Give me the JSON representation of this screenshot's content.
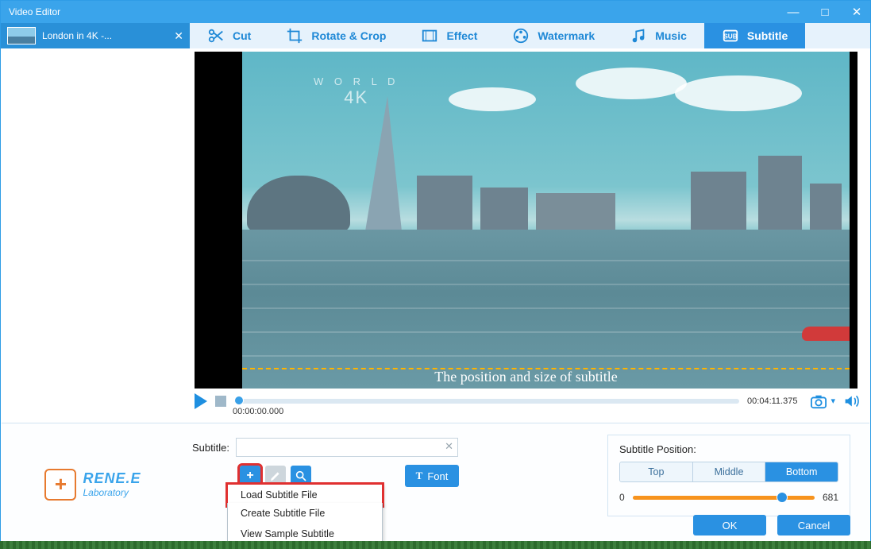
{
  "titlebar": {
    "title": "Video Editor"
  },
  "file_tab": {
    "name": "London in 4K -..."
  },
  "toolbar": {
    "cut": "Cut",
    "rotate": "Rotate & Crop",
    "effect": "Effect",
    "watermark": "Watermark",
    "music": "Music",
    "subtitle": "Subtitle"
  },
  "preview": {
    "watermark_line1": "W O R L D",
    "watermark_line2": "4K",
    "subtitle_sample": "The position and size of subtitle"
  },
  "playback": {
    "current_time": "00:00:00.000",
    "total_time": "00:04:11.375"
  },
  "logo": {
    "line1": "RENE.E",
    "line2": "Laboratory",
    "badge": "+"
  },
  "subtitle_panel": {
    "label": "Subtitle:",
    "input_value": "",
    "font_button": "Font",
    "menu": {
      "load": "Load Subtitle File",
      "create": "Create Subtitle File",
      "sample": "View Sample Subtitle"
    }
  },
  "position_panel": {
    "title": "Subtitle Position:",
    "top": "Top",
    "middle": "Middle",
    "bottom": "Bottom",
    "min": "0",
    "max": "681"
  },
  "actions": {
    "ok": "OK",
    "cancel": "Cancel"
  }
}
